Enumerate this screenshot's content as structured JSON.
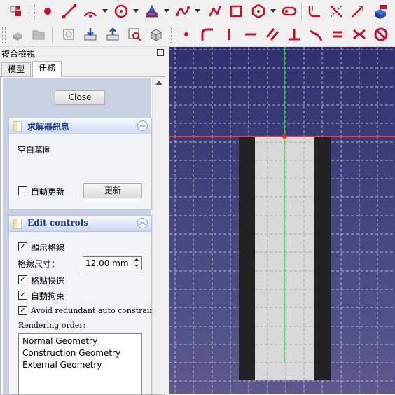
{
  "panel": {
    "title": "複合檢視",
    "tabs": [
      {
        "label": "模型"
      },
      {
        "label": "任務"
      }
    ],
    "close_label": "Close"
  },
  "solver": {
    "title": "求解器訊息",
    "status": "空白草圖",
    "auto_update_label": "自動更新",
    "auto_update_checked": false,
    "update_button_label": "更新"
  },
  "edit_controls": {
    "title": "Edit controls",
    "show_grid_label": "顯示格線",
    "show_grid_checked": true,
    "grid_size_label": "格線尺寸：",
    "grid_size_value": "12.00 mm",
    "grid_snap_label": "格點快選",
    "grid_snap_checked": true,
    "auto_constraints_label": "自動拘束",
    "auto_constraints_checked": true,
    "avoid_redundant_label": "Avoid redundant auto constraints",
    "avoid_redundant_checked": true,
    "rendering_order_label": "Rendering order:",
    "rendering_order": [
      "Normal Geometry",
      "Construction Geometry",
      "External Geometry"
    ]
  },
  "toolbar1": {
    "icons": [
      "sketcher-view-icon",
      "point-icon",
      "line-icon",
      "arc-icon",
      "circle-icon",
      "conic-icon",
      "bspline-icon",
      "polyline-icon",
      "rectangle-icon",
      "polygon-icon",
      "slot-icon",
      "fillet-icon",
      "trim-icon",
      "extend-icon",
      "external-geometry-icon"
    ]
  },
  "toolbar2": {
    "icons": [
      "part-icon",
      "folder-icon",
      "sketch-map-icon",
      "reorient-icon",
      "validate-icon",
      "merge-icon",
      "mirror-icon",
      "constraint-point-icon",
      "constraint-coincident-icon",
      "constraint-vertical-icon",
      "constraint-horizontal-icon",
      "constraint-parallel-icon",
      "constraint-perpendicular-icon",
      "constraint-tangent-icon",
      "constraint-equal-icon",
      "constraint-symmetric-icon",
      "constraint-block-icon"
    ]
  },
  "colors": {
    "viewport_top": "#303070",
    "viewport_bottom": "#5a5a90",
    "grid": "#c8c8dc",
    "x_axis": "#ff4d4d",
    "y_axis": "#33dd33",
    "solid": "#222222",
    "construction": "#d9d9d9",
    "icon_red": "#c8102e"
  }
}
